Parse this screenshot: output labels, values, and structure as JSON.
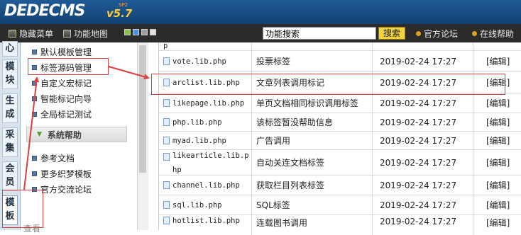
{
  "header": {
    "logo": "DEDECMS",
    "version": "v5.7",
    "edition": "SP2"
  },
  "toolbar": {
    "hide_menu": "隐藏菜单",
    "function_map": "功能地图",
    "search_value": "功能搜索",
    "search_button": "搜索",
    "official_forum": "官方论坛",
    "online_help": "在线帮助",
    "swatches": [
      "#8bc34a",
      "#4a90d9",
      "#9e9e9e",
      "#e0e0e0"
    ]
  },
  "tabs": [
    "心",
    "模块",
    "生成",
    "采集",
    "会员",
    "模板"
  ],
  "menu": {
    "items_top": [
      "默认模板管理",
      "标签源码管理",
      "自定义宏标记",
      "智能标记向导",
      "全局标记测试"
    ],
    "section": "系统帮助",
    "items_bottom": [
      "参考文档",
      "更多织梦模板",
      "官方交流论坛"
    ],
    "last_cut": "查看"
  },
  "table": {
    "top_partial": "p",
    "rows": [
      {
        "file": "vote.lib.php",
        "desc": "投票标签",
        "date": "2019-02-24 17:27",
        "action": "[编辑]"
      },
      {
        "file": "arclist.lib.php",
        "desc": "文章列表调用标记",
        "date": "2019-02-24 17:27",
        "action": "[编辑]"
      },
      {
        "file": "likepage.lib.php",
        "desc": "单页文档相同标识调用标签",
        "date": "2019-02-24 17:27",
        "action": "[编辑]"
      },
      {
        "file": "php.lib.php",
        "desc": "该标签暂没帮助信息",
        "date": "2019-02-24 17:27",
        "action": "[编辑]"
      },
      {
        "file": "myad.lib.php",
        "desc": "广告调用",
        "date": "2019-02-24 17:27",
        "action": "[编辑]"
      },
      {
        "file": "likearticle.lib.php",
        "desc": "自动关连文档标签",
        "date": "2019-02-24 17:27",
        "action": "[编辑]"
      },
      {
        "file": "channel.lib.php",
        "desc": "获取栏目列表标签",
        "date": "2019-02-24 17:27",
        "action": "[编辑]"
      },
      {
        "file": "sql.lib.php",
        "desc": "SQL标签",
        "date": "2019-02-24 17:27",
        "action": "[编辑]"
      },
      {
        "file": "hotlist.lib.php",
        "desc": "连载图书调用",
        "date": "2019-02-24 17:27",
        "action": "[编辑]"
      }
    ]
  }
}
